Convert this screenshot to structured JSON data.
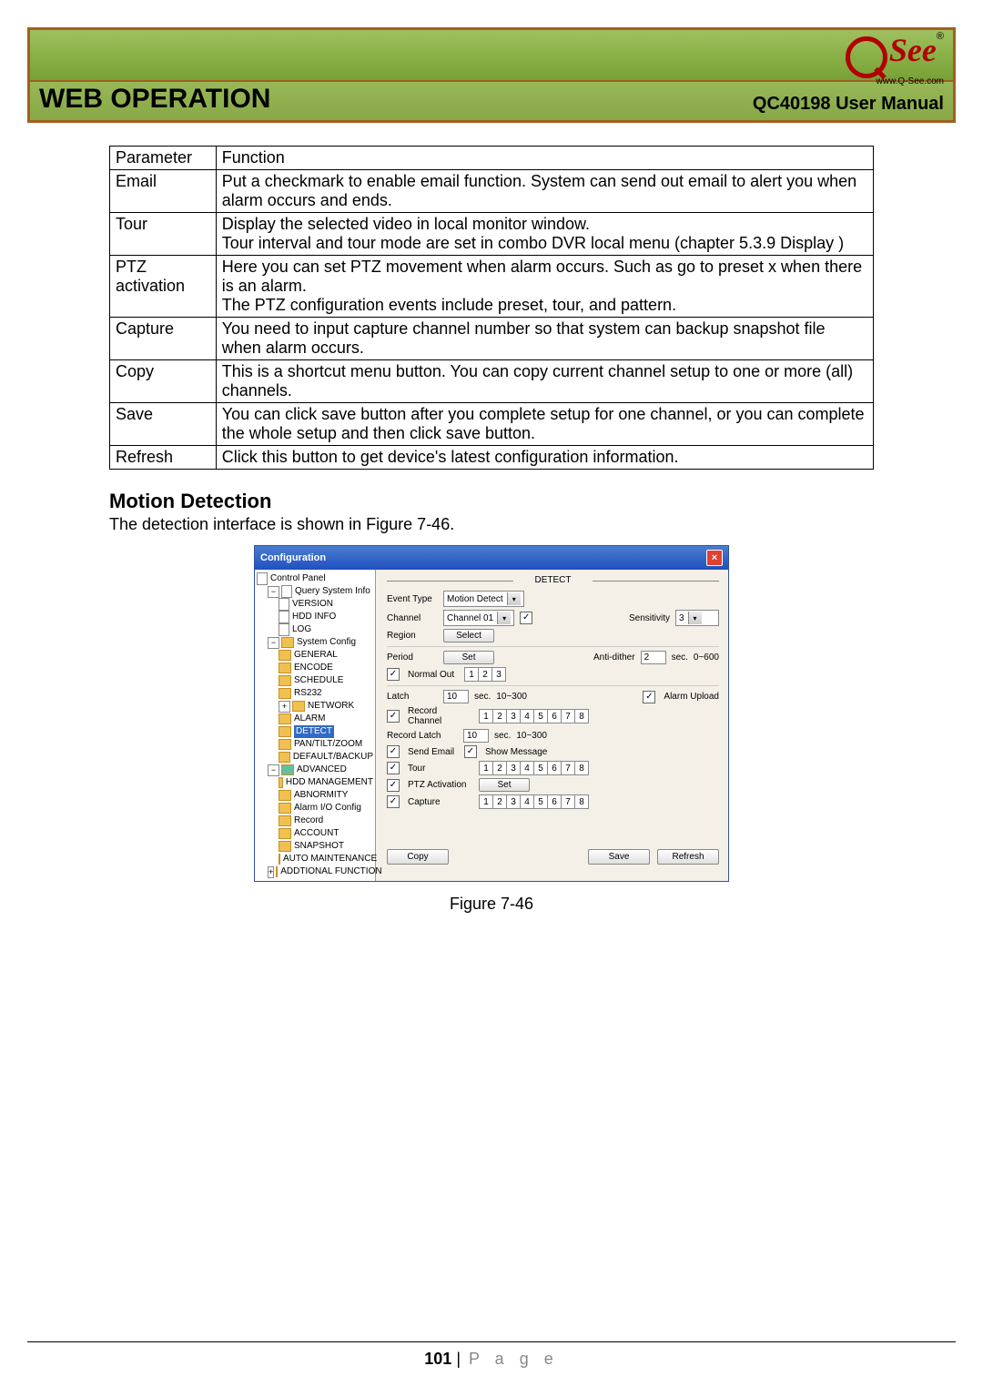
{
  "header": {
    "logo_text": "See",
    "logo_sub": "www.Q-See.com",
    "title_left": "WEB OPERATION",
    "title_right": "QC40198 User Manual"
  },
  "table": {
    "head": {
      "c1": "Parameter",
      "c2": "Function"
    },
    "rows": [
      {
        "p": "Email",
        "f": "Put a checkmark to enable email function. System can send out email to alert you when alarm occurs and ends."
      },
      {
        "p": "Tour",
        "f": "Display the selected video in local monitor window.\nTour interval and tour mode are set in combo DVR local menu (chapter 5.3.9 Display )"
      },
      {
        "p": "PTZ activation",
        "f": "Here you can set PTZ movement when alarm occurs. Such as go to preset x when there is an alarm.\nThe PTZ configuration events include preset, tour, and pattern."
      },
      {
        "p": "Capture",
        "f": "You need to input capture channel number so that system can backup snapshot file when alarm occurs."
      },
      {
        "p": "Copy",
        "f": "This is a shortcut menu button. You can copy current channel setup to one or more (all) channels."
      },
      {
        "p": "Save",
        "f": "You can click save button after you complete setup for one channel, or you can complete the whole setup and then click save button."
      },
      {
        "p": "Refresh",
        "f": "Click this button to get device's latest configuration information."
      }
    ]
  },
  "section": {
    "heading": "Motion Detection",
    "body": "The detection interface is shown in Figure 7-46.",
    "caption": "Figure 7-46"
  },
  "dialog": {
    "title": "Configuration",
    "close": "×",
    "tree": {
      "root": "Control Panel",
      "g1": "Query System Info",
      "g1_items": [
        "VERSION",
        "HDD INFO",
        "LOG"
      ],
      "g2": "System Config",
      "g2_items": [
        "GENERAL",
        "ENCODE",
        "SCHEDULE",
        "RS232",
        "NETWORK",
        "ALARM",
        "DETECT",
        "PAN/TILT/ZOOM",
        "DEFAULT/BACKUP"
      ],
      "g3": "ADVANCED",
      "g3_items": [
        "HDD MANAGEMENT",
        "ABNORMITY",
        "Alarm I/O Config",
        "Record",
        "ACCOUNT",
        "SNAPSHOT",
        "AUTO MAINTENANCE"
      ],
      "g4": "ADDTIONAL FUNCTION"
    },
    "panel": {
      "section_title": "DETECT",
      "labels": {
        "event_type": "Event Type",
        "channel": "Channel",
        "region": "Region",
        "period": "Period",
        "normal_out": "Normal Out",
        "latch": "Latch",
        "record_channel": "Record Channel",
        "record_latch": "Record Latch",
        "send_email": "Send Email",
        "show_message": "Show Message",
        "tour": "Tour",
        "ptz_activation": "PTZ Activation",
        "capture": "Capture",
        "sensitivity": "Sensitivity",
        "anti_dither": "Anti-dither",
        "alarm_upload": "Alarm Upload"
      },
      "values": {
        "event_type": "Motion Detect",
        "channel": "Channel 01",
        "sensitivity": "3",
        "select_btn": "Select",
        "set_btn": "Set",
        "anti_dither_val": "2",
        "anti_dither_unit": "sec.",
        "anti_dither_range": "0~600",
        "latch_val": "10",
        "latch_unit": "sec.",
        "latch_range": "10~300",
        "record_latch_val": "10",
        "record_latch_unit": "sec.",
        "record_latch_range": "10~300",
        "copy_btn": "Copy",
        "save_btn": "Save",
        "refresh_btn": "Refresh",
        "nums3": [
          "1",
          "2",
          "3"
        ],
        "nums8": [
          "1",
          "2",
          "3",
          "4",
          "5",
          "6",
          "7",
          "8"
        ]
      }
    }
  },
  "footer": {
    "page_num": "101",
    "page_label": "P a g e",
    "sep": " | "
  }
}
